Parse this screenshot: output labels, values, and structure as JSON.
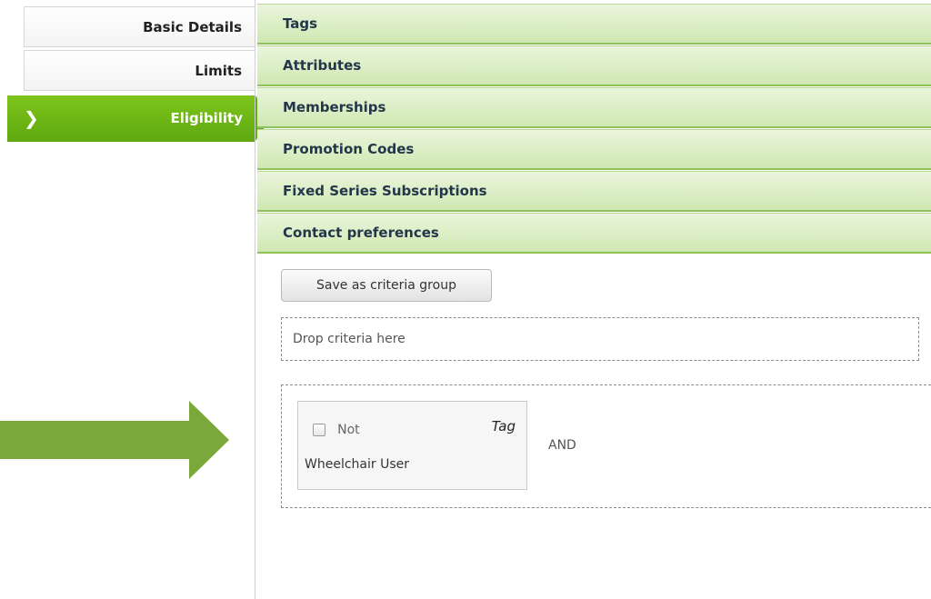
{
  "nav": {
    "items": [
      {
        "label": "Basic Details"
      },
      {
        "label": "Limits"
      },
      {
        "label": "Eligibility",
        "active": true,
        "chevron": "❯"
      }
    ]
  },
  "accordion": {
    "sections": [
      {
        "label": "Tags"
      },
      {
        "label": "Attributes"
      },
      {
        "label": "Memberships"
      },
      {
        "label": "Promotion Codes"
      },
      {
        "label": "Fixed Series Subscriptions"
      },
      {
        "label": "Contact preferences"
      }
    ]
  },
  "criteria": {
    "save_button_label": "Save as criteria group",
    "drop_placeholder": "Drop criteria here",
    "card": {
      "not_label": "Not",
      "not_checked": false,
      "type_label": "Tag",
      "name": "Wheelchair User"
    },
    "operator": "AND"
  },
  "colors": {
    "active_green": "#6cb515",
    "accordion_green": "#cfe8b2",
    "arrow_green": "#7aa83a"
  },
  "icons": {
    "chevron": "chevron-right-icon",
    "pointer": "arrow-right-icon",
    "checkbox": "checkbox-icon"
  }
}
